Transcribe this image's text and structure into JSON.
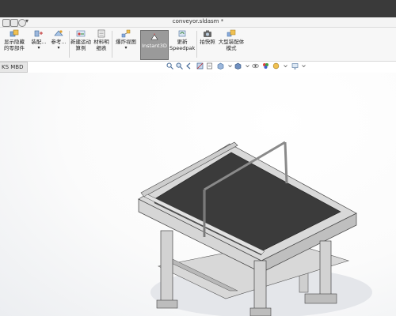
{
  "window": {
    "title": "conveyor.sldasm *"
  },
  "ribbon": {
    "buttons": [
      {
        "label": "显示隐藏的零部件",
        "icon": "show-hide-components-icon"
      },
      {
        "label": "装配...",
        "icon": "mate-icon"
      },
      {
        "label": "参考...",
        "icon": "reference-geometry-icon"
      },
      {
        "label": "新建运动算例",
        "icon": "new-motion-study-icon"
      },
      {
        "label": "材料明细表",
        "icon": "bill-of-materials-icon"
      },
      {
        "label": "爆炸视图",
        "icon": "exploded-view-icon"
      },
      {
        "label": "Instant3D",
        "icon": "instant3d-icon",
        "active": true
      },
      {
        "label": "更新Speedpak",
        "icon": "update-speedpak-icon"
      },
      {
        "label": "拍快照",
        "icon": "snapshot-icon"
      },
      {
        "label": "大型装配体模式",
        "icon": "large-assembly-mode-icon"
      }
    ]
  },
  "tabs": {
    "mbd_label": "KS MBD"
  },
  "heads_up_toolbar": {
    "icons": [
      "zoom-to-fit-icon",
      "zoom-to-area-icon",
      "previous-view-icon",
      "section-view-icon",
      "dynamic-annotation-icon",
      "view-orientation-icon",
      "display-style-icon",
      "hide-show-items-icon",
      "edit-appearance-icon",
      "apply-scene-icon",
      "view-settings-icon"
    ]
  },
  "colors": {
    "title_bar": "#3a3a3a",
    "active_button": "#9a9a9a",
    "belt": "#3b3b3b",
    "frame": "#c9c9c9"
  }
}
